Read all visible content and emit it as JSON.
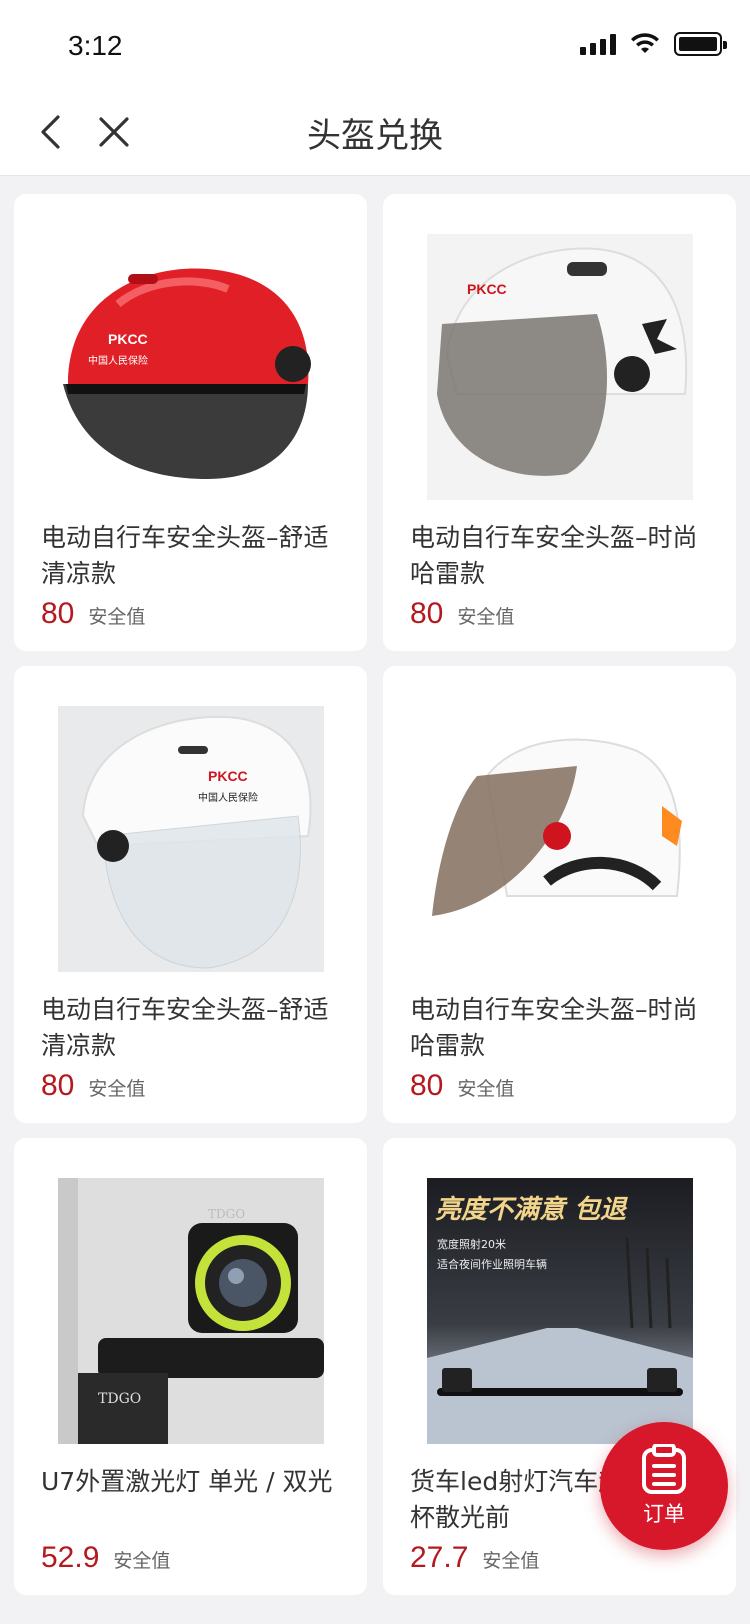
{
  "status_bar": {
    "time": "3:12"
  },
  "nav": {
    "title": "头盔兑换"
  },
  "products": [
    {
      "title": "电动自行车安全头盔–舒适清凉款",
      "price": "80",
      "unit": "安全值",
      "image": "red-helmet-pkcc"
    },
    {
      "title": "电动自行车安全头盔–时尚哈雷款",
      "price": "80",
      "unit": "安全值",
      "image": "white-helmet-harley"
    },
    {
      "title": "电动自行车安全头盔–舒适清凉款",
      "price": "80",
      "unit": "安全值",
      "image": "white-helmet-clear-visor"
    },
    {
      "title": "电动自行车安全头盔–时尚哈雷款",
      "price": "80",
      "unit": "安全值",
      "image": "white-helmet-tinted-visor"
    },
    {
      "title": "U7外置激光灯 单光 / 双光",
      "price": "52.9",
      "unit": "安全值",
      "image": "u7-laser-light"
    },
    {
      "title": "货车led射灯汽车超亮反光杯散光前",
      "price": "27.7",
      "unit": "安全值",
      "image": "truck-led-light"
    }
  ],
  "product_images": {
    "light_ad_headline": "亮度不满意 包退",
    "light_ad_line1": "宽度照射20米",
    "light_ad_line2": "适合夜间作业照明车辆",
    "helmet_logo": "PKCC",
    "helmet_logo_cn": "中国人民保险",
    "light_brand": "TDGO"
  },
  "order_button": {
    "label": "订单"
  },
  "colors": {
    "accent": "#d7182a",
    "price": "#b5191f"
  }
}
